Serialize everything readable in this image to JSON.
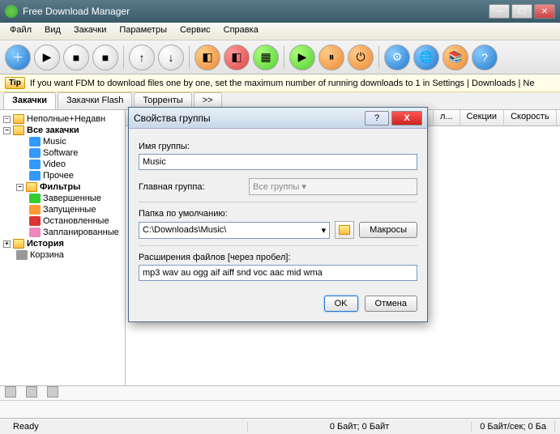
{
  "window": {
    "title": "Free Download Manager"
  },
  "menu": {
    "file": "Файл",
    "view": "Вид",
    "downloads": "Закачки",
    "options": "Параметры",
    "service": "Сервис",
    "help": "Справка"
  },
  "tip": {
    "badge": "Tip",
    "text": "If you want FDM to download files one by one, set the maximum number of running downloads to 1 in Settings | Downloads | Ne"
  },
  "tabs": {
    "downloads": "Закачки",
    "flash": "Закачки Flash",
    "torrents": "Торренты",
    "more": ">>"
  },
  "tree": {
    "incomplete": "Неполные+Недавн",
    "all": "Все закачки",
    "music": "Music",
    "software": "Software",
    "video": "Video",
    "other": "Прочее",
    "filters": "Фильтры",
    "completed": "Завершенные",
    "running": "Запущенные",
    "stopped": "Остановленные",
    "scheduled": "Запланированные",
    "history": "История",
    "trash": "Корзина"
  },
  "columns": {
    "url": "л...",
    "sections": "Секции",
    "speed": "Скорость"
  },
  "dialog": {
    "title": "Свойства группы",
    "name_label": "Имя группы:",
    "name_value": "Music",
    "parent_label": "Главная группа:",
    "parent_value": "Все группы",
    "folder_label": "Папка по умолчанию:",
    "folder_value": "C:\\Downloads\\Music\\",
    "macros": "Макросы",
    "ext_label": "Расширения файлов [через пробел]:",
    "ext_value": "mp3 wav au ogg aif aiff snd voc aac mid wma",
    "ok": "OK",
    "cancel": "Отмена"
  },
  "status": {
    "ready": "Ready",
    "bytes": "0 Байт; 0 Байт",
    "speed": "0 Байт/сек; 0 Ба"
  }
}
